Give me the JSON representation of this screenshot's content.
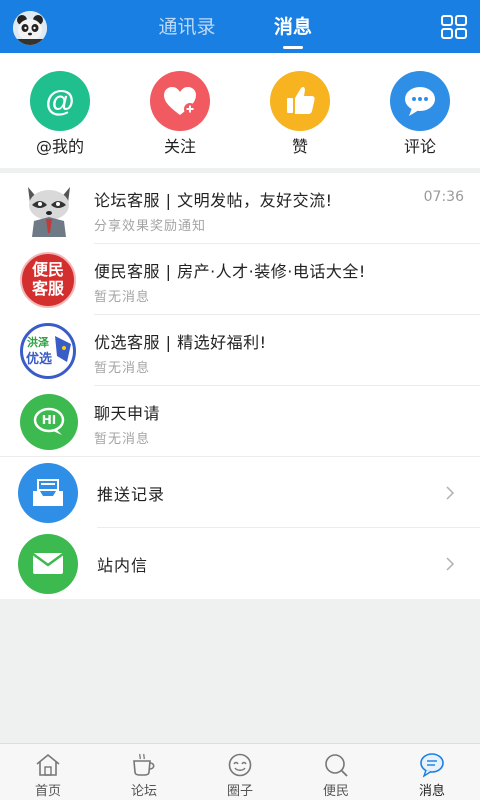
{
  "header": {
    "tabs": [
      {
        "label": "通讯录",
        "active": false
      },
      {
        "label": "消息",
        "active": true
      }
    ],
    "brand_color": "#1a7fe3"
  },
  "quick_actions": [
    {
      "label": "@我的",
      "icon": "at-icon",
      "color": "#1fbf8e"
    },
    {
      "label": "关注",
      "icon": "heart-plus-icon",
      "color": "#f05a60"
    },
    {
      "label": "赞",
      "icon": "thumbs-up-icon",
      "color": "#f7b320"
    },
    {
      "label": "评论",
      "icon": "comment-icon",
      "color": "#2f8fe6"
    }
  ],
  "messages": [
    {
      "title": "论坛客服 | 文明发帖，友好交流!",
      "subtitle": "分享效果奖励通知",
      "time": "07:36",
      "icon": "raccoon-avatar"
    },
    {
      "title": "便民客服 | 房产·人才·装修·电话大全!",
      "subtitle": "暂无消息",
      "time": "",
      "icon": "bianmin-logo",
      "logo_text": [
        "便民",
        "客服"
      ]
    },
    {
      "title": "优选客服 | 精选好福利!",
      "subtitle": "暂无消息",
      "time": "",
      "icon": "youxuan-logo",
      "logo_text": [
        "洪泽",
        "优选"
      ]
    },
    {
      "title": "聊天申请",
      "subtitle": "暂无消息",
      "time": "",
      "icon": "hi-chat-icon",
      "icon_text": "HI"
    }
  ],
  "links": [
    {
      "label": "推送记录",
      "icon": "inbox-tray-icon",
      "color": "#2f8fe6"
    },
    {
      "label": "站内信",
      "icon": "envelope-icon",
      "color": "#3cb94f"
    }
  ],
  "bottom_nav": [
    {
      "label": "首页",
      "icon": "home-icon",
      "active": false
    },
    {
      "label": "论坛",
      "icon": "coffee-cup-icon",
      "active": false
    },
    {
      "label": "圈子",
      "icon": "smile-circle-icon",
      "active": false
    },
    {
      "label": "便民",
      "icon": "search-bubble-icon",
      "active": false
    },
    {
      "label": "消息",
      "icon": "message-bubble-icon",
      "active": true
    }
  ]
}
